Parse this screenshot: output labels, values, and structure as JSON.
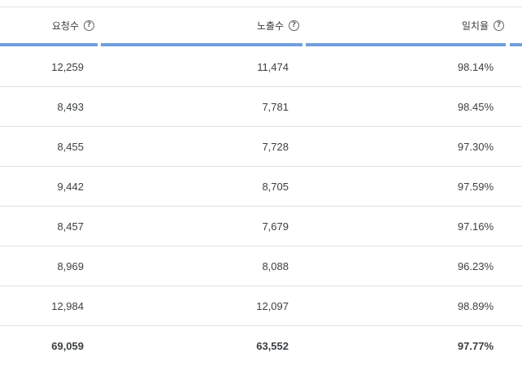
{
  "table": {
    "columns": [
      {
        "label": "요청수",
        "help_icon": "help-circle-icon"
      },
      {
        "label": "노출수",
        "help_icon": "help-circle-icon"
      },
      {
        "label": "일치율",
        "help_icon": "help-circle-icon"
      }
    ],
    "help_glyph": "?",
    "accent_color": "#6f9fdd",
    "rows": [
      {
        "requests": "12,259",
        "impressions": "11,474",
        "match_rate": "98.14%"
      },
      {
        "requests": "8,493",
        "impressions": "7,781",
        "match_rate": "98.45%"
      },
      {
        "requests": "8,455",
        "impressions": "7,728",
        "match_rate": "97.30%"
      },
      {
        "requests": "9,442",
        "impressions": "8,705",
        "match_rate": "97.59%"
      },
      {
        "requests": "8,457",
        "impressions": "7,679",
        "match_rate": "97.16%"
      },
      {
        "requests": "8,969",
        "impressions": "8,088",
        "match_rate": "96.23%"
      },
      {
        "requests": "12,984",
        "impressions": "12,097",
        "match_rate": "98.89%"
      }
    ],
    "total": {
      "requests": "69,059",
      "impressions": "63,552",
      "match_rate": "97.77%"
    }
  }
}
